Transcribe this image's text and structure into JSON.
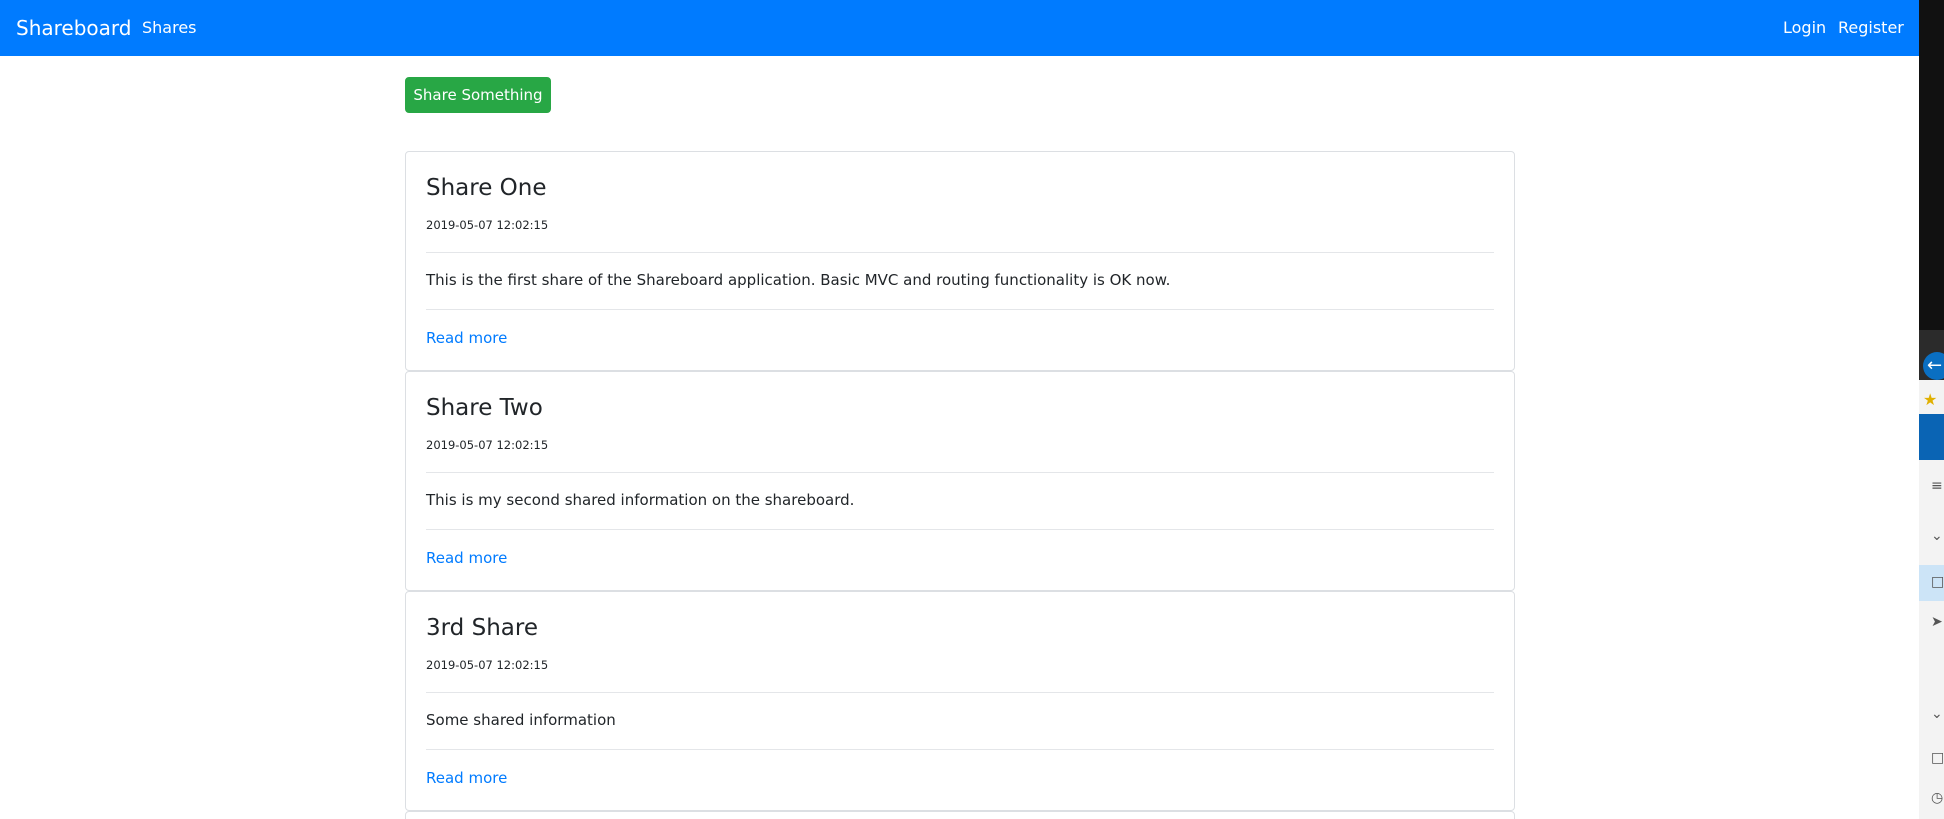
{
  "navbar": {
    "brand": "Shareboard",
    "links": {
      "shares": "Shares",
      "login": "Login",
      "register": "Register"
    },
    "background": "#007bff"
  },
  "actions": {
    "share_button_label": "Share Something",
    "share_button_color": "#28a745"
  },
  "shares": [
    {
      "title": "Share One",
      "date": "2019-05-07 12:02:15",
      "body": "This is the first share of the Shareboard application. Basic MVC and routing functionality is OK now.",
      "link_label": "Read more"
    },
    {
      "title": "Share Two",
      "date": "2019-05-07 12:02:15",
      "body": "This is my second shared information on the shareboard.",
      "link_label": "Read more"
    },
    {
      "title": "3rd Share",
      "date": "2019-05-07 12:02:15",
      "body": "Some shared information",
      "link_label": "Read more"
    }
  ],
  "side_window": {
    "icons": [
      "back-arrow-icon",
      "star-icon",
      "menu-icon",
      "chevron-down-icon",
      "document-icon",
      "send-icon",
      "clock-icon"
    ]
  }
}
